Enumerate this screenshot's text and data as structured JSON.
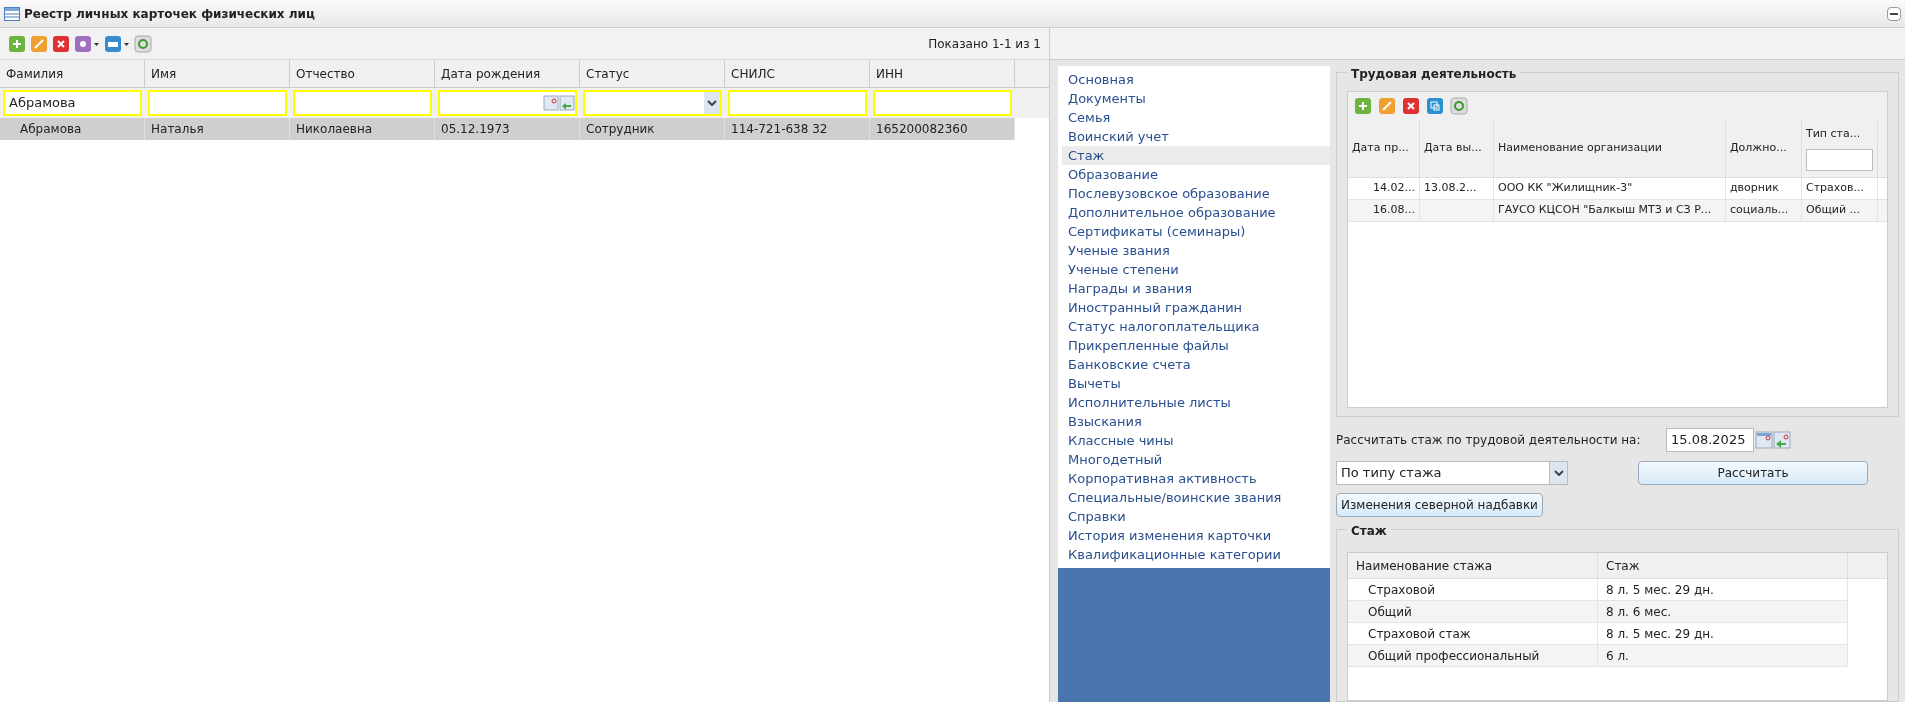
{
  "window": {
    "title": "Реестр личных карточек физических лиц"
  },
  "left_toolbar": {
    "paging": "Показано 1-1 из 1"
  },
  "registry": {
    "columns": [
      "Фамилия",
      "Имя",
      "Отчество",
      "Дата рождения",
      "Статус",
      "СНИЛС",
      "ИНН"
    ],
    "filters": [
      {
        "kind": "text",
        "value": "Абрамова"
      },
      {
        "kind": "text"
      },
      {
        "kind": "text"
      },
      {
        "kind": "date"
      },
      {
        "kind": "select"
      },
      {
        "kind": "text"
      },
      {
        "kind": "text"
      }
    ],
    "rows": [
      {
        "selected": true,
        "cells": [
          "Абрамова",
          "Наталья",
          "Николаевна",
          "05.12.1973",
          "Сотрудник",
          "114-721-638 32",
          "165200082360"
        ]
      }
    ]
  },
  "sections": [
    {
      "label": "Основная",
      "selected": false
    },
    {
      "label": "Документы",
      "selected": false
    },
    {
      "label": "Семья",
      "selected": false
    },
    {
      "label": "Воинский учет",
      "selected": false
    },
    {
      "label": "Стаж",
      "selected": true
    },
    {
      "label": "Образование",
      "selected": false
    },
    {
      "label": "Послевузовское образование",
      "selected": false
    },
    {
      "label": "Дополнительное образование",
      "selected": false
    },
    {
      "label": "Сертификаты (семинары)",
      "selected": false
    },
    {
      "label": "Ученые звания",
      "selected": false
    },
    {
      "label": "Ученые степени",
      "selected": false
    },
    {
      "label": "Награды и звания",
      "selected": false
    },
    {
      "label": "Иностранный гражданин",
      "selected": false
    },
    {
      "label": "Статус налогоплательщика",
      "selected": false
    },
    {
      "label": "Прикрепленные файлы",
      "selected": false
    },
    {
      "label": "Банковские счета",
      "selected": false
    },
    {
      "label": "Вычеты",
      "selected": false
    },
    {
      "label": "Исполнительные листы",
      "selected": false
    },
    {
      "label": "Взыскания",
      "selected": false
    },
    {
      "label": "Классные чины",
      "selected": false
    },
    {
      "label": "Многодетный",
      "selected": false
    },
    {
      "label": "Корпоративная активность",
      "selected": false
    },
    {
      "label": "Специальные/воинские звания",
      "selected": false
    },
    {
      "label": "Справки",
      "selected": false
    },
    {
      "label": "История изменения карточки",
      "selected": false
    },
    {
      "label": "Квалификационные категории",
      "selected": false
    }
  ],
  "work": {
    "title": "Трудовая деятельность",
    "columns": [
      "Дата пр...",
      "Дата вы...",
      "Наименование организации",
      "Должно...",
      "Тип ста..."
    ],
    "rows": [
      [
        "14.02...",
        "13.08.2...",
        "ООО КК \"Жилищник-3\"",
        "дворник",
        "Страхов..."
      ],
      [
        "16.08...",
        "",
        "ГАУСО КЦСОН \"Балкыш МТЗ и СЗ Р...",
        "социаль...",
        "Общий ..."
      ]
    ]
  },
  "calc": {
    "label": "Рассчитать стаж по трудовой деятельности на:",
    "date": "15.08.2025",
    "mode": "По типу стажа",
    "calc_button": "Рассчитать",
    "north_button": "Изменения северной надбавки"
  },
  "seniority": {
    "title": "Стаж",
    "columns": [
      "Наименование стажа",
      "Стаж"
    ],
    "rows": [
      [
        "Страховой",
        "8 л. 5 мес. 29 дн."
      ],
      [
        "Общий",
        "8 л. 6 мес."
      ],
      [
        "Страховой стаж",
        "8 л. 5 мес. 29 дн."
      ],
      [
        "Общий профессиональный",
        "6 л."
      ]
    ]
  }
}
